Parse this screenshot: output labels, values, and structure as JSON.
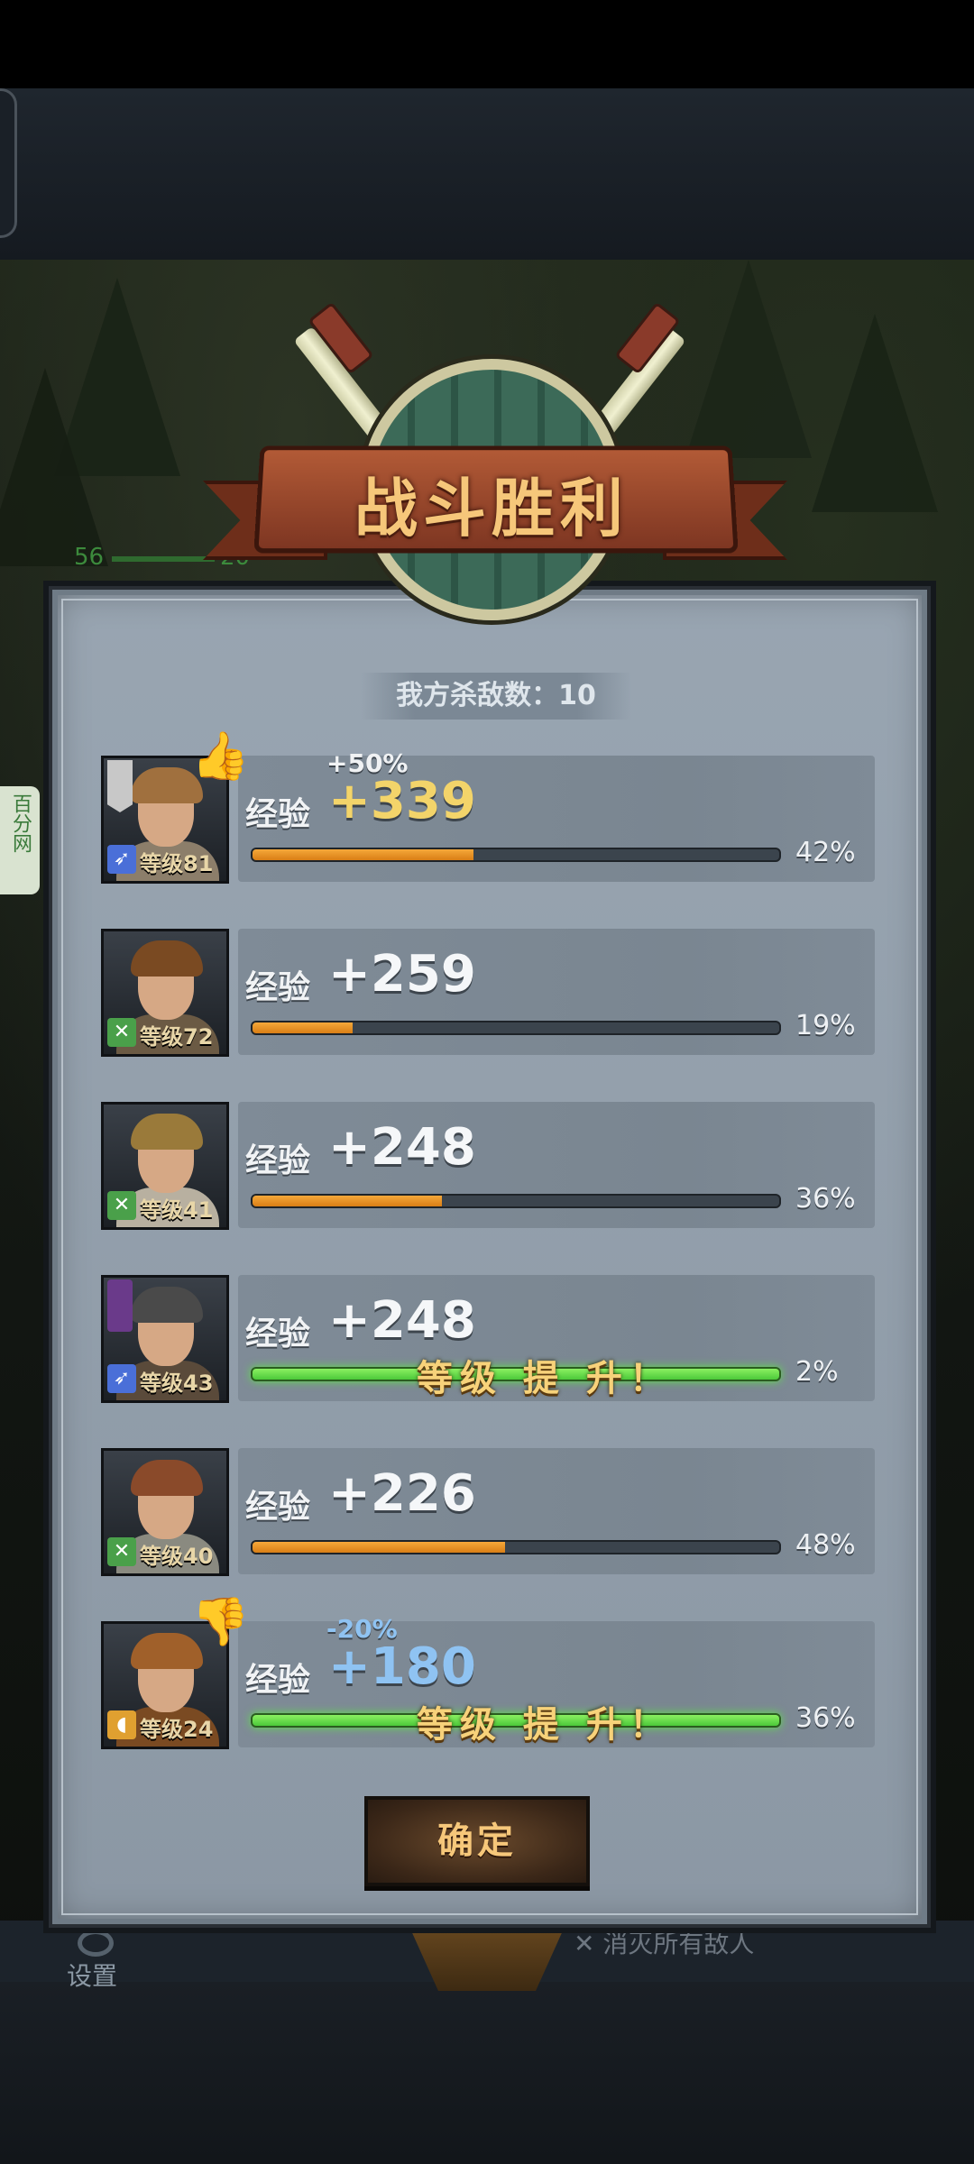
{
  "scene": {
    "hp_left": "56",
    "hp_right": "20",
    "side_tab": "百分网",
    "settings_label": "设置",
    "hint_text": "消灭所有敌人"
  },
  "dialog": {
    "title": "战斗胜利",
    "kills_label": "我方杀敌数：10",
    "exp_label": "经验",
    "levelup_text": "等级 提 升！",
    "confirm_label": "确定"
  },
  "heroes": [
    {
      "level": "等级81",
      "exp": "+339",
      "bonus": "+50%",
      "progress": 42,
      "pct": "42%",
      "levelup": false,
      "class_icon": "spear-icon",
      "mark": "thumbs-up-icon"
    },
    {
      "level": "等级72",
      "exp": "+259",
      "bonus": "",
      "progress": 19,
      "pct": "19%",
      "levelup": false,
      "class_icon": "bow-icon",
      "mark": ""
    },
    {
      "level": "等级41",
      "exp": "+248",
      "bonus": "",
      "progress": 36,
      "pct": "36%",
      "levelup": false,
      "class_icon": "bow-icon",
      "mark": ""
    },
    {
      "level": "等级43",
      "exp": "+248",
      "bonus": "",
      "progress": 100,
      "pct": "2%",
      "levelup": true,
      "class_icon": "spear-icon",
      "mark": ""
    },
    {
      "level": "等级40",
      "exp": "+226",
      "bonus": "",
      "progress": 48,
      "pct": "48%",
      "levelup": false,
      "class_icon": "bow-icon",
      "mark": ""
    },
    {
      "level": "等级24",
      "exp": "+180",
      "bonus": "-20%",
      "progress": 100,
      "pct": "36%",
      "levelup": true,
      "class_icon": "shield-icon",
      "mark": "thumbs-down-icon"
    }
  ],
  "colors": {
    "accent_gold": "#f6c77a",
    "exp_bar": "#f5a83a",
    "levelup_bar": "#6ee04d",
    "penalty_blue": "#8fc3f2",
    "bonus_gold": "#f3d46a"
  }
}
